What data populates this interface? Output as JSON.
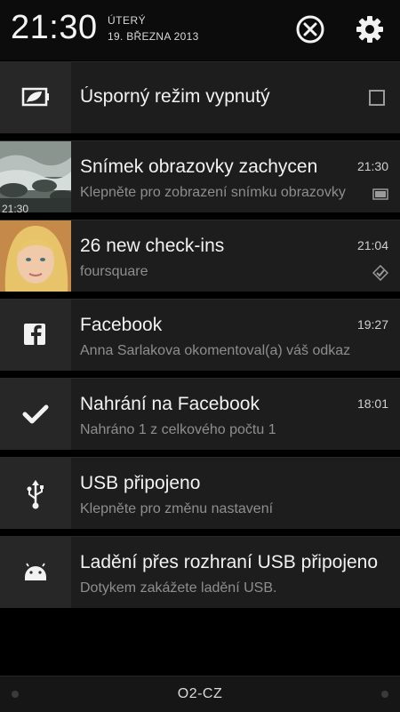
{
  "status": {
    "clock": "21:30",
    "weekday": "ÚTERÝ",
    "date": "19. BŘEZNA 2013"
  },
  "header_icons": {
    "close": "close-circle-icon",
    "settings": "gear-icon"
  },
  "notifications": [
    {
      "title": "Úsporný režim vypnutý",
      "icon": "battery-saver-icon",
      "checked": false
    },
    {
      "title": "Snímek obrazovky zachycen",
      "subtitle": "Klepněte pro zobrazení snímku obrazovky",
      "time": "21:30",
      "icon": "screenshot-thumbnail",
      "small_icon": "image-icon",
      "thumb_text": "21:30"
    },
    {
      "title": "26 new check-ins",
      "subtitle": "foursquare",
      "time": "21:04",
      "icon": "avatar-photo",
      "small_icon": "foursquare-icon"
    },
    {
      "title": "Facebook",
      "subtitle": "Anna Sarlakova okomentoval(a) váš odkaz",
      "time": "19:27",
      "icon": "facebook-icon"
    },
    {
      "title": "Nahrání na Facebook",
      "subtitle": "Nahráno 1 z celkového počtu 1",
      "time": "18:01",
      "icon": "checkmark-icon"
    },
    {
      "title": "USB připojeno",
      "subtitle": "Klepněte pro změnu nastavení",
      "icon": "usb-icon"
    },
    {
      "title": "Ladění přes rozhraní USB připojeno",
      "subtitle": "Dotykem zakážete ladění USB.",
      "icon": "android-icon"
    }
  ],
  "footer": {
    "carrier": "O2-CZ"
  },
  "colors": {
    "background": "#000000",
    "card": "#1d1d1d",
    "icon_cell": "#272727",
    "subtitle": "#8e8e8e"
  }
}
